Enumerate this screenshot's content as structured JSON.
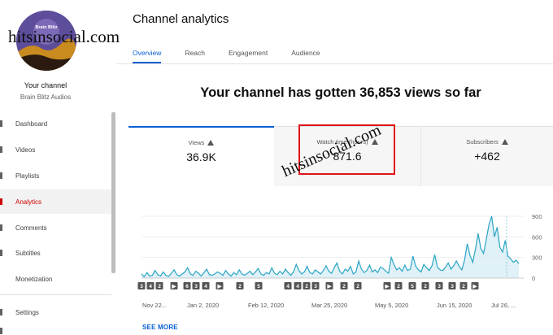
{
  "channel": {
    "name": "Your channel",
    "handle": "Brain Blitz Audios",
    "avatar_text": "Brain Blitz"
  },
  "sidebar": {
    "items": [
      {
        "label": "Dashboard"
      },
      {
        "label": "Videos"
      },
      {
        "label": "Playlists"
      },
      {
        "label": "Analytics"
      },
      {
        "label": "Comments"
      },
      {
        "label": "Subtitles"
      },
      {
        "label": "Monetization"
      },
      {
        "label": "Settings"
      }
    ],
    "active": "Analytics"
  },
  "header": {
    "title": "Channel analytics",
    "tabs": [
      {
        "label": "Overview"
      },
      {
        "label": "Reach"
      },
      {
        "label": "Engagement"
      },
      {
        "label": "Audience"
      }
    ]
  },
  "headline": "Your channel has gotten 36,853 views so far",
  "metrics": [
    {
      "label": "Views",
      "value": "36.9K"
    },
    {
      "label": "Watch time (hours)",
      "value": "871.6"
    },
    {
      "label": "Subscribers",
      "value": "+462"
    }
  ],
  "see_more": "SEE MORE",
  "watermarks": [
    "hitsinsocial.com",
    "hitsinsocial.com"
  ],
  "colors": {
    "accent": "#065fd4",
    "active_nav": "#cc0000",
    "chart_line": "#2aa5c4",
    "chart_fill": "#d8eef5",
    "highlight": "#e0141a"
  },
  "chart_data": {
    "type": "area",
    "x_ticks": [
      "Nov 22...",
      "Jan 2, 2020",
      "Feb 12, 2020",
      "Mar 25, 2020",
      "May 5, 2020",
      "Jun 15, 2020",
      "Jul 26, ..."
    ],
    "y_ticks": [
      "900",
      "600",
      "300",
      "0"
    ],
    "ylim": [
      0,
      900
    ],
    "grid": true,
    "series": [
      {
        "values": [
          60,
          20,
          80,
          30,
          40,
          110,
          50,
          30,
          90,
          40,
          25,
          70,
          120,
          50,
          30,
          60,
          90,
          150,
          60,
          40,
          100,
          70,
          30,
          80,
          130,
          50,
          40,
          60,
          90,
          70,
          40,
          110,
          60,
          30,
          80,
          50,
          120,
          60,
          40,
          70,
          100,
          50,
          90,
          140,
          60,
          40,
          80,
          60,
          150,
          70,
          50,
          100,
          60,
          130,
          80,
          40,
          90,
          200,
          110,
          60,
          90,
          170,
          80,
          60,
          120,
          90,
          60,
          110,
          180,
          100,
          70,
          150,
          220,
          100,
          60,
          130,
          100,
          170,
          60,
          90,
          250,
          130,
          80,
          110,
          190,
          90,
          120,
          80,
          160,
          140,
          100,
          70,
          300,
          200,
          120,
          150,
          100,
          190,
          110,
          130,
          320,
          170,
          120,
          90,
          200,
          150,
          110,
          180,
          340,
          160,
          120,
          110,
          160,
          220,
          130,
          180,
          250,
          170,
          120,
          260,
          500,
          330,
          230,
          420,
          650,
          430,
          360,
          560,
          780,
          920,
          600,
          740,
          450,
          380,
          550,
          320,
          280,
          230,
          260,
          210
        ]
      }
    ],
    "timeline_markers": [
      "3",
      "4",
      "2",
      "▶",
      "6",
      "3",
      "4",
      "▶",
      "2",
      "5",
      "4",
      "4",
      "2",
      "3",
      "▶",
      "2",
      "2",
      "▶",
      "2",
      "5",
      "2",
      "3",
      "3",
      "2",
      "▶"
    ]
  }
}
